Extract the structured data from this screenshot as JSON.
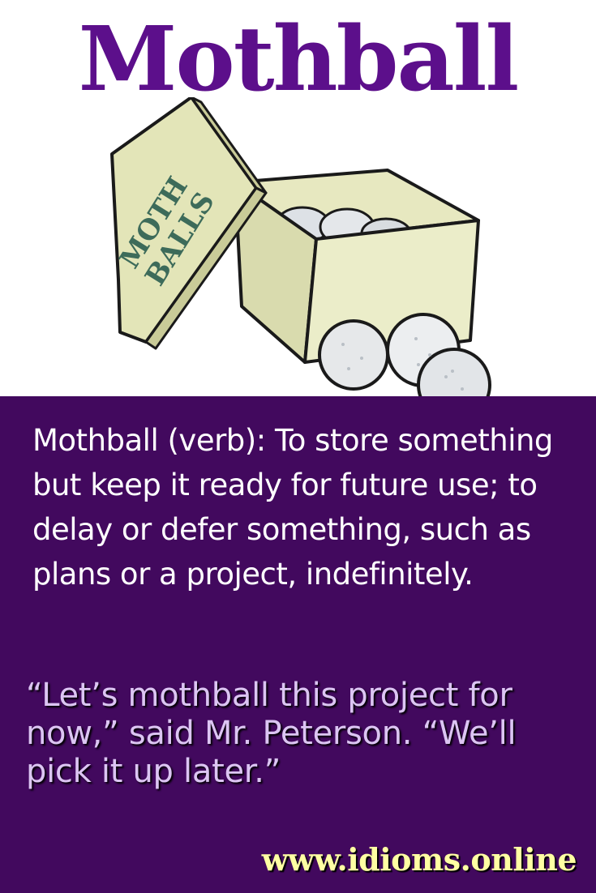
{
  "title": "Mothball",
  "illustration": {
    "box_label_line1": "MOTH",
    "box_label_line2": "BALLS"
  },
  "definition": "Mothball (verb): To store something but keep it ready for future use; to delay or defer something, such as plans or a project, indefinitely.",
  "example": "“Let’s mothball this project for now,” said Mr. Peterson. “We’ll pick it up later.”",
  "website": "www.idioms.online",
  "colors": {
    "title": "#5c0f8b",
    "panel_background": "#42095e",
    "definition_text": "#ffffff",
    "example_text": "#dcc5f3",
    "website_text": "#ffffa3"
  }
}
